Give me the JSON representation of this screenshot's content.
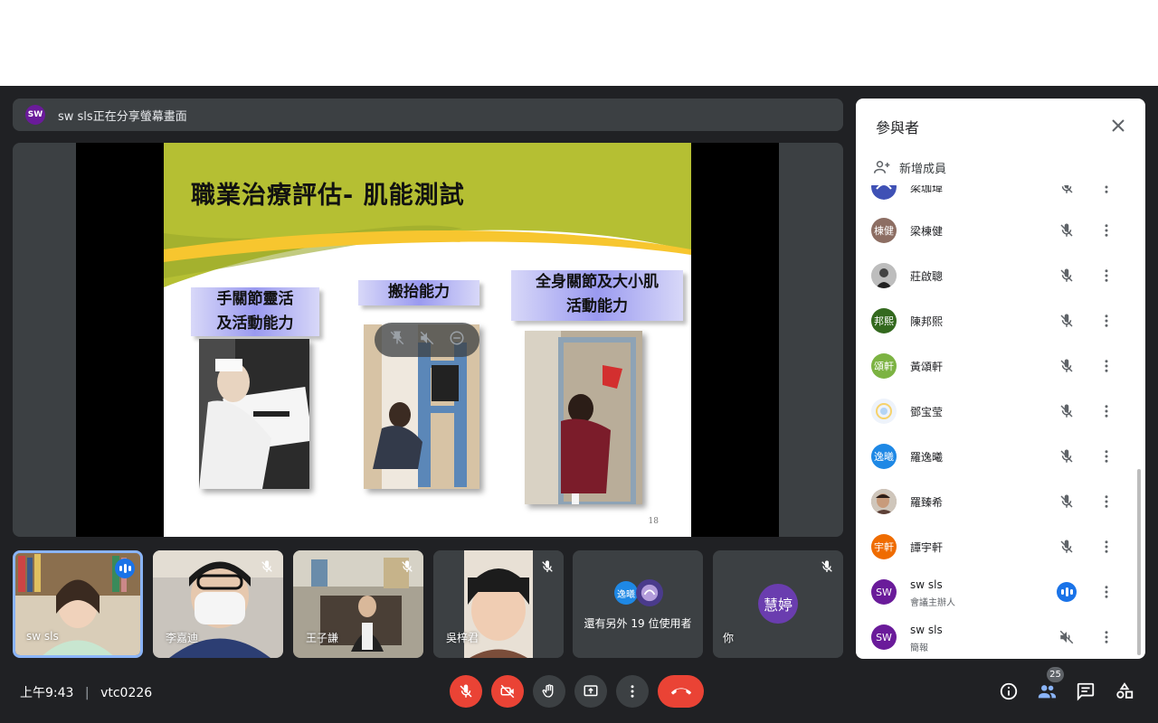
{
  "banner": {
    "avatar": "SW",
    "text": "sw sls正在分享螢幕畫面"
  },
  "slide": {
    "title": "職業治療評估- 肌能測試",
    "box1": [
      "手關節靈活",
      "及活動能力"
    ],
    "box2": [
      "搬抬能力"
    ],
    "box3": [
      "全身關節及大小肌",
      "活動能力"
    ],
    "page_number": "18"
  },
  "tiles": [
    {
      "name": "sw sls",
      "status": "speaking"
    },
    {
      "name": "李嘉迪",
      "status": "muted"
    },
    {
      "name": "王子謙",
      "status": "muted"
    },
    {
      "name": "吳梓君",
      "status": "muted"
    },
    {
      "name": "",
      "others_text": "還有另外 19 位使用者",
      "avatar1": "逸曦"
    },
    {
      "name": "你",
      "avatar": "慧婷",
      "status": "muted"
    }
  ],
  "bottom": {
    "time": "上午9:43",
    "separator": "|",
    "meeting_code": "vtc0226",
    "participant_count": "25"
  },
  "panel": {
    "title": "參與者",
    "add_member": "新增成員",
    "participants": [
      {
        "name": "梁珈瑋",
        "avatar": "",
        "avatar_color": "#e8eaf6",
        "mic": "muted"
      },
      {
        "name": "梁棟健",
        "avatar": "棟健",
        "avatar_color": "#8d6e63",
        "mic": "muted"
      },
      {
        "name": "莊啟聰",
        "avatar": "",
        "avatar_color": "#616161",
        "mic": "muted"
      },
      {
        "name": "陳邦熙",
        "avatar": "邦熙",
        "avatar_color": "#33691e",
        "mic": "muted"
      },
      {
        "name": "黃頌軒",
        "avatar": "頌軒",
        "avatar_color": "#7cb342",
        "mic": "muted"
      },
      {
        "name": "鄧宝莹",
        "avatar": "",
        "avatar_color": "#eef3fb",
        "mic": "muted"
      },
      {
        "name": "羅逸曦",
        "avatar": "逸曦",
        "avatar_color": "#1e88e5",
        "mic": "muted"
      },
      {
        "name": "羅臻希",
        "avatar": "",
        "avatar_color": "#a1887f",
        "mic": "muted"
      },
      {
        "name": "譚宇軒",
        "avatar": "宇軒",
        "avatar_color": "#ef6c00",
        "mic": "muted"
      },
      {
        "name": "sw sls",
        "sub": "會議主辦人",
        "avatar": "SW",
        "avatar_color": "#6a1b9a",
        "mic": "speaking"
      },
      {
        "name": "sw sls",
        "sub": "簡報",
        "avatar": "SW",
        "avatar_color": "#6a1b9a",
        "mic": "volume-off"
      }
    ]
  }
}
